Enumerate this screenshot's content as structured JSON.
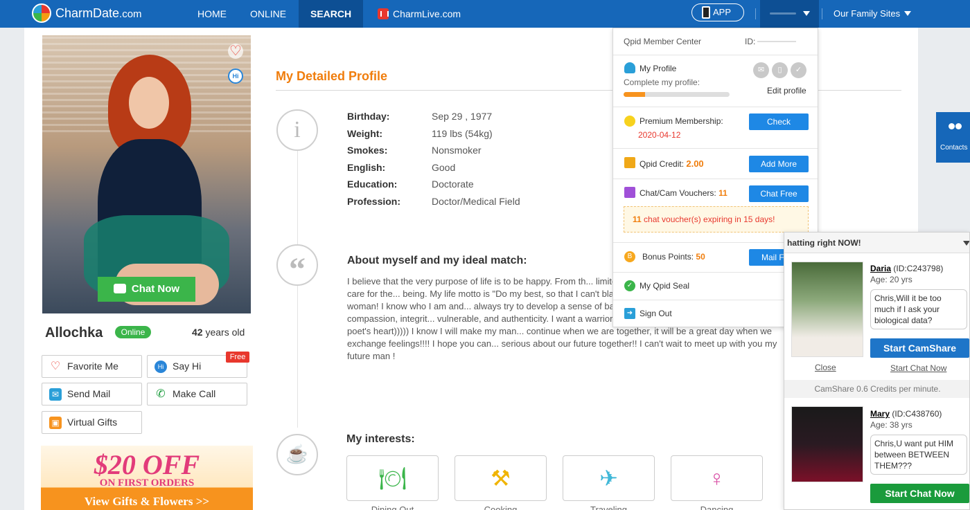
{
  "nav": {
    "logo_main": "CharmDate",
    "logo_suffix": ".com",
    "links": [
      "HOME",
      "ONLINE",
      "SEARCH"
    ],
    "live_link": "CharmLive.com",
    "app_label": "APP",
    "family_sites": "Our Family Sites",
    "accent": "#1667b9"
  },
  "profile": {
    "name": "Allochka",
    "status": "Online",
    "age_number": "42",
    "age_suffix": " years old",
    "chat_now": "Chat Now",
    "hi_badge": "Hi",
    "buttons": {
      "favorite": "Favorite Me",
      "say_hi": "Say Hi",
      "free_tag": "Free",
      "send_mail": "Send Mail",
      "make_call": "Make Call",
      "virtual_gifts": "Virtual Gifts"
    },
    "promo": {
      "headline": "$20 OFF",
      "sub": "ON FIRST ORDERS",
      "cta": "View Gifts & Flowers >>"
    }
  },
  "details": {
    "title": "My Detailed Profile",
    "rows": [
      {
        "label": "Birthday:",
        "value": "Sep 29 , 1977"
      },
      {
        "label": "Weight:",
        "value": "119 lbs (54kg)"
      },
      {
        "label": "Smokes:",
        "value": "Nonsmoker"
      },
      {
        "label": "English:",
        "value": "Good"
      },
      {
        "label": "Education:",
        "value": "Doctorate"
      },
      {
        "label": "Profession:",
        "value": "Doctor/Medical Field"
      }
    ],
    "about_title": "About myself and my ideal match:",
    "about_text": "I believe that the very purpose of life is to be happy. From th... limited experience I have found that the more we care for the... being. My life motto is \"Do my best, so that I can't blame mys... I think about myself as a strong woman! I know who I am and... always try to develop a sense of balance. I am filled with kindness, generosity, compassion, integrit... vulnerable, and authenticity. I want a warrior man with wild eyes, strong hands and a poet's heart))))) I know I will make my man... continue when we are together, it will be a great day when we exchange feelings!!!! I hope you can... serious about our future together!! I can't wait to meet up with you my future man !",
    "interests_title": "My interests:",
    "interests": [
      {
        "label": "Dining Out",
        "icon": "dining-icon",
        "color": "#3bb54a"
      },
      {
        "label": "Cooking",
        "icon": "cooking-icon",
        "color": "#f0b400"
      },
      {
        "label": "Traveling",
        "icon": "airplane-icon",
        "color": "#41b8d8"
      },
      {
        "label": "Dancing",
        "icon": "dancer-icon",
        "color": "#d94fa6"
      }
    ]
  },
  "member_menu": {
    "title": "Qpid Member Center",
    "id_label": "ID:",
    "my_profile": "My Profile",
    "complete": "Complete my profile:",
    "edit_profile": "Edit profile",
    "profile_progress": 0.2,
    "premium_label": "Premium Membership:",
    "premium_date": "2020-04-12",
    "check": "Check",
    "credit_label": "Qpid Credit: ",
    "credit_value": "2.00",
    "add_more": "Add More",
    "vouchers_label": "Chat/Cam Vouchers: ",
    "vouchers_value": "11",
    "chat_free": "Chat Free",
    "voucher_count": "11",
    "voucher_note": " chat voucher(s) expiring in 15 days!",
    "bonus_label": "Bonus Points: ",
    "bonus_value": "50",
    "mail_free": "Mail Free",
    "seal": "My Qpid Seal",
    "sign_out": "Sign Out"
  },
  "contacts_tab": "Contacts",
  "chat_panel": {
    "header": "hatting right NOW!",
    "ladies": [
      {
        "name": "Daria",
        "id": " (ID:C243798)",
        "age": "Age: 20 yrs",
        "message": "Chris,Will it be too much if I ask your biological data?",
        "button": "Start CamShare",
        "close": "Close",
        "start_chat": "Start Chat Now"
      },
      {
        "name": "Mary",
        "id": " (ID:C438760)",
        "age": "Age: 38 yrs",
        "message": "Chris,U want put HIM between BETWEEN THEM???",
        "button": "Start Chat Now"
      }
    ],
    "cam_note": "CamShare 0.6 Credits per minute."
  }
}
